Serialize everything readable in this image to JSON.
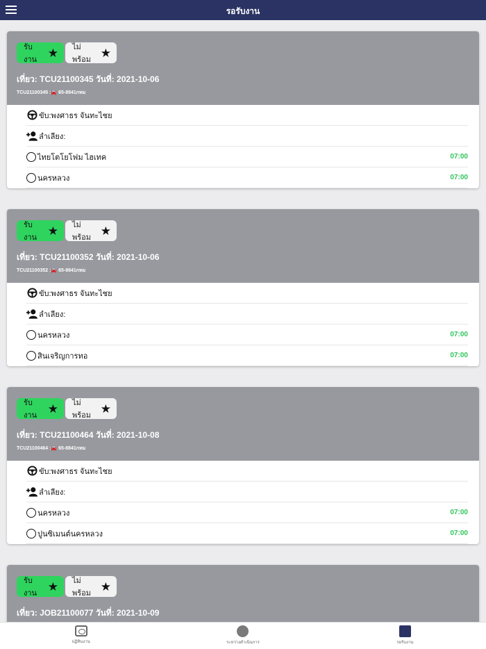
{
  "header": {
    "title": "รอรับงาน"
  },
  "button_labels": {
    "accept": "รับงาน",
    "not_ready": "ไม่พร้อม"
  },
  "cards": [
    {
      "trip_line": "เที่ยว: TCU21100345 วันที่: 2021-10-06",
      "sub_line": "TCU21100345 :🚘 65-8841กทม",
      "driver": "ขับ:พงศาธร จันทะไชย",
      "assistant": "ลำเลียง:",
      "stops": [
        {
          "name": "ไทยโตโยโฟม ไฮเทค",
          "time": "07:00"
        },
        {
          "name": "นครหลวง",
          "time": "07:00"
        }
      ]
    },
    {
      "trip_line": "เที่ยว: TCU21100352 วันที่: 2021-10-06",
      "sub_line": "TCU21100352 :🚘 65-8841กทม",
      "driver": "ขับ:พงศาธร จันทะไชย",
      "assistant": "ลำเลียง:",
      "stops": [
        {
          "name": "นครหลวง",
          "time": "07:00"
        },
        {
          "name": "สินเจริญการทอ",
          "time": "07:00"
        }
      ]
    },
    {
      "trip_line": "เที่ยว: TCU21100464 วันที่: 2021-10-08",
      "sub_line": "TCU21100464 :🚘 65-8841กทม",
      "driver": "ขับ:พงศาธร จันทะไชย",
      "assistant": "ลำเลียง:",
      "stops": [
        {
          "name": "นครหลวง",
          "time": "07:00"
        },
        {
          "name": "ปูนซิเมนต์นครหลวง",
          "time": "07:00"
        }
      ]
    },
    {
      "trip_line": "เที่ยว: JOB21100077 วันที่: 2021-10-09"
    }
  ],
  "bottom_nav": [
    {
      "label": "ปฏิทินงาน",
      "icon": "calendar-icon"
    },
    {
      "label": "ระหว่างดำเนินการ",
      "icon": "circle-icon"
    },
    {
      "label": "รอรับงาน",
      "icon": "square-icon"
    }
  ],
  "colors": {
    "header_bg": "#2a3363",
    "card_head_bg": "#97999f",
    "accept_bg": "#2fd45e",
    "time": "#2fc45a"
  }
}
